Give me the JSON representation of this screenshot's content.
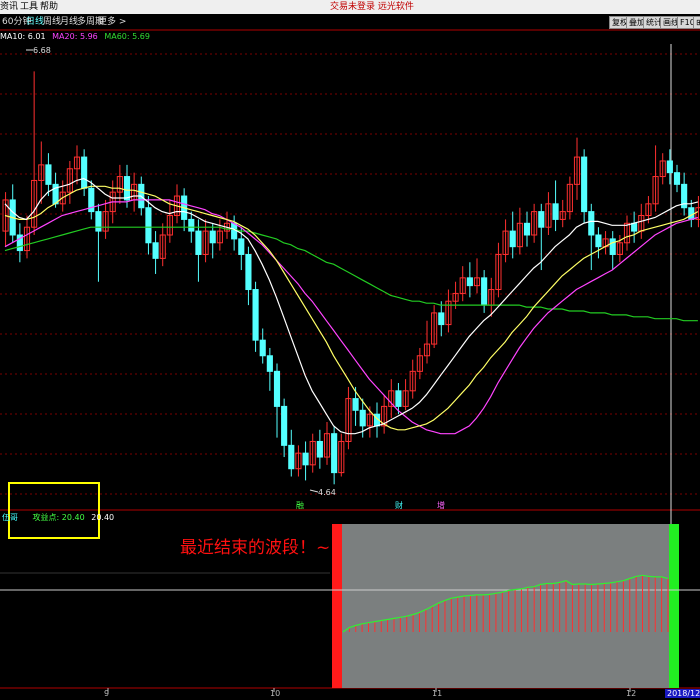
{
  "topbar": {
    "menu": [
      "资讯",
      "工具",
      "帮助"
    ],
    "title": "交易未登录 远光软件"
  },
  "tabbar": {
    "period": "60分钟",
    "tabs": [
      "日线",
      "周线",
      "月线",
      "多周期",
      "更多 >"
    ],
    "active_tab": "日线",
    "buttons": [
      "复权",
      "叠加",
      "统计",
      "画线",
      "F10"
    ],
    "extra_button": "⊞"
  },
  "ma_legend": {
    "ma10": "MA10: 6.01",
    "ma20": "MA20: 5.96",
    "ma60": "MA60: 5.69"
  },
  "price_labels": {
    "high": "6.68",
    "low": "4.64"
  },
  "event_marks": [
    "融",
    "财",
    "增"
  ],
  "indicator": {
    "name": "伍哥",
    "series_name": "攻益点: 20.40",
    "value": "20.40"
  },
  "annotation": "最近结束的波段！~",
  "x_ticks": [
    "9",
    "10",
    "11",
    "12",
    "2018/12/"
  ],
  "colors": {
    "up": "#ff3030",
    "down": "#54ffff",
    "ma10": "#ffffff",
    "ma20": "#ffff66",
    "ma30": "#ff44ff",
    "ma60": "#22cc22",
    "grid": "#7a0000",
    "band": "#7b7f7f",
    "band_start": "#ff1a1a",
    "band_end": "#22ee22"
  },
  "chart_data": [
    {
      "type": "candlestick",
      "title": "",
      "y_range": [
        4.5,
        6.8
      ],
      "candles": [
        [
          5.86,
          6.02,
          5.78,
          6.06
        ],
        [
          6.02,
          5.84,
          5.8,
          6.1
        ],
        [
          5.84,
          5.76,
          5.7,
          5.9
        ],
        [
          5.76,
          5.88,
          5.72,
          5.94
        ],
        [
          5.88,
          6.12,
          5.84,
          6.68
        ],
        [
          6.12,
          6.2,
          6.0,
          6.32
        ],
        [
          6.2,
          6.1,
          6.04,
          6.26
        ],
        [
          6.1,
          6.0,
          5.98,
          6.16
        ],
        [
          6.0,
          6.06,
          5.96,
          6.12
        ],
        [
          6.06,
          6.18,
          6.0,
          6.22
        ],
        [
          6.18,
          6.24,
          6.1,
          6.3
        ],
        [
          6.24,
          6.08,
          6.04,
          6.28
        ],
        [
          6.08,
          5.96,
          5.92,
          6.12
        ],
        [
          5.96,
          5.86,
          5.6,
          6.0
        ],
        [
          5.86,
          5.96,
          5.82,
          6.02
        ],
        [
          5.96,
          6.06,
          5.9,
          6.12
        ],
        [
          6.06,
          6.14,
          6.0,
          6.2
        ],
        [
          6.14,
          6.02,
          5.98,
          6.2
        ],
        [
          6.02,
          6.1,
          5.96,
          6.16
        ],
        [
          6.1,
          5.98,
          5.94,
          6.14
        ],
        [
          5.98,
          5.8,
          5.74,
          6.04
        ],
        [
          5.8,
          5.72,
          5.64,
          5.86
        ],
        [
          5.72,
          5.84,
          5.68,
          5.9
        ],
        [
          5.84,
          5.94,
          5.8,
          6.02
        ],
        [
          5.94,
          6.04,
          5.9,
          6.1
        ],
        [
          6.04,
          5.92,
          5.86,
          6.08
        ],
        [
          5.92,
          5.86,
          5.8,
          5.96
        ],
        [
          5.86,
          5.74,
          5.6,
          5.92
        ],
        [
          5.74,
          5.86,
          5.7,
          5.92
        ],
        [
          5.86,
          5.8,
          5.72,
          5.9
        ],
        [
          5.8,
          5.86,
          5.76,
          5.92
        ],
        [
          5.86,
          5.9,
          5.82,
          5.96
        ],
        [
          5.9,
          5.82,
          5.76,
          5.94
        ],
        [
          5.82,
          5.74,
          5.66,
          5.88
        ],
        [
          5.74,
          5.56,
          5.48,
          5.78
        ],
        [
          5.56,
          5.3,
          5.24,
          5.6
        ],
        [
          5.3,
          5.22,
          5.18,
          5.36
        ],
        [
          5.22,
          5.14,
          5.04,
          5.26
        ],
        [
          5.14,
          4.96,
          4.8,
          5.18
        ],
        [
          4.96,
          4.76,
          4.7,
          5.0
        ],
        [
          4.76,
          4.64,
          4.6,
          4.84
        ],
        [
          4.64,
          4.72,
          4.6,
          4.76
        ],
        [
          4.72,
          4.66,
          4.58,
          4.78
        ],
        [
          4.66,
          4.78,
          4.62,
          4.82
        ],
        [
          4.78,
          4.7,
          4.64,
          4.84
        ],
        [
          4.7,
          4.82,
          4.66,
          4.88
        ],
        [
          4.82,
          4.62,
          4.56,
          4.86
        ],
        [
          4.62,
          4.78,
          4.6,
          4.82
        ],
        [
          4.78,
          5.0,
          4.74,
          5.06
        ],
        [
          5.0,
          4.94,
          4.86,
          5.06
        ],
        [
          4.94,
          4.86,
          4.8,
          5.0
        ],
        [
          4.86,
          4.92,
          4.8,
          4.96
        ],
        [
          4.92,
          4.86,
          4.8,
          4.98
        ],
        [
          4.86,
          4.96,
          4.82,
          5.02
        ],
        [
          4.96,
          5.04,
          4.9,
          5.1
        ],
        [
          5.04,
          4.96,
          4.92,
          5.08
        ],
        [
          4.96,
          5.04,
          4.94,
          5.1
        ],
        [
          5.04,
          5.14,
          5.0,
          5.2
        ],
        [
          5.14,
          5.22,
          5.1,
          5.26
        ],
        [
          5.22,
          5.28,
          5.18,
          5.4
        ],
        [
          5.28,
          5.44,
          5.26,
          5.48
        ],
        [
          5.44,
          5.38,
          5.32,
          5.5
        ],
        [
          5.38,
          5.5,
          5.34,
          5.56
        ],
        [
          5.5,
          5.54,
          5.46,
          5.6
        ],
        [
          5.54,
          5.62,
          5.5,
          5.68
        ],
        [
          5.62,
          5.58,
          5.52,
          5.7
        ],
        [
          5.58,
          5.62,
          5.54,
          5.72
        ],
        [
          5.62,
          5.48,
          5.44,
          5.66
        ],
        [
          5.48,
          5.56,
          5.42,
          5.62
        ],
        [
          5.56,
          5.74,
          5.52,
          5.8
        ],
        [
          5.74,
          5.86,
          5.7,
          5.92
        ],
        [
          5.86,
          5.78,
          5.72,
          5.96
        ],
        [
          5.78,
          5.9,
          5.74,
          5.98
        ],
        [
          5.9,
          5.84,
          5.78,
          5.96
        ],
        [
          5.84,
          5.96,
          5.8,
          6.0
        ],
        [
          5.96,
          5.88,
          5.66,
          6.0
        ],
        [
          5.88,
          6.0,
          5.84,
          6.06
        ],
        [
          6.0,
          5.92,
          5.86,
          6.12
        ],
        [
          5.92,
          5.96,
          5.88,
          6.02
        ],
        [
          5.96,
          6.1,
          5.92,
          6.14
        ],
        [
          6.1,
          6.24,
          6.02,
          6.34
        ],
        [
          6.24,
          5.96,
          5.9,
          6.28
        ],
        [
          5.96,
          5.84,
          5.66,
          6.0
        ],
        [
          5.84,
          5.78,
          5.72,
          5.88
        ],
        [
          5.78,
          5.82,
          5.74,
          5.86
        ],
        [
          5.82,
          5.74,
          5.66,
          5.86
        ],
        [
          5.74,
          5.8,
          5.7,
          5.84
        ],
        [
          5.8,
          5.9,
          5.76,
          5.94
        ],
        [
          5.9,
          5.86,
          5.8,
          5.96
        ],
        [
          5.86,
          5.94,
          5.82,
          6.0
        ],
        [
          5.94,
          6.0,
          5.9,
          6.04
        ],
        [
          6.0,
          6.14,
          5.96,
          6.3
        ],
        [
          6.14,
          6.22,
          6.1,
          6.26
        ],
        [
          6.22,
          6.16,
          6.1,
          6.28
        ],
        [
          6.16,
          6.1,
          6.06,
          6.2
        ],
        [
          6.1,
          5.98,
          5.94,
          6.16
        ],
        [
          5.98,
          5.92,
          5.88,
          6.02
        ],
        [
          5.92,
          5.98,
          5.88,
          6.04
        ]
      ],
      "ma10": [
        6.0,
        5.96,
        5.93,
        5.92,
        5.96,
        6.02,
        6.06,
        6.08,
        6.09,
        6.1,
        6.12,
        6.13,
        6.11,
        6.08,
        6.05,
        6.03,
        6.03,
        6.03,
        6.04,
        6.04,
        6.01,
        5.98,
        5.96,
        5.95,
        5.96,
        5.96,
        5.95,
        5.93,
        5.91,
        5.9,
        5.89,
        5.88,
        5.87,
        5.85,
        5.82,
        5.76,
        5.69,
        5.61,
        5.52,
        5.42,
        5.32,
        5.22,
        5.12,
        5.04,
        4.98,
        4.92,
        4.86,
        4.83,
        4.82,
        4.82,
        4.83,
        4.85,
        4.86,
        4.87,
        4.89,
        4.91,
        4.93,
        4.95,
        4.98,
        5.02,
        5.07,
        5.12,
        5.17,
        5.22,
        5.27,
        5.32,
        5.36,
        5.4,
        5.43,
        5.47,
        5.51,
        5.55,
        5.59,
        5.63,
        5.67,
        5.7,
        5.74,
        5.78,
        5.81,
        5.84,
        5.88,
        5.9,
        5.91,
        5.91,
        5.9,
        5.89,
        5.89,
        5.89,
        5.9,
        5.91,
        5.92,
        5.93,
        5.95,
        5.97,
        5.99,
        6.0,
        6.0,
        6.01
      ],
      "ma20": [
        5.94,
        5.93,
        5.92,
        5.92,
        5.93,
        5.95,
        5.98,
        6.0,
        6.03,
        6.05,
        6.07,
        6.08,
        6.09,
        6.09,
        6.09,
        6.08,
        6.08,
        6.07,
        6.07,
        6.06,
        6.05,
        6.04,
        6.02,
        6.0,
        5.99,
        5.98,
        5.97,
        5.96,
        5.95,
        5.94,
        5.93,
        5.92,
        5.91,
        5.89,
        5.87,
        5.84,
        5.8,
        5.76,
        5.71,
        5.65,
        5.59,
        5.53,
        5.47,
        5.41,
        5.35,
        5.29,
        5.22,
        5.16,
        5.1,
        5.04,
        4.99,
        4.94,
        4.9,
        4.87,
        4.85,
        4.84,
        4.84,
        4.85,
        4.86,
        4.87,
        4.89,
        4.92,
        4.95,
        4.99,
        5.03,
        5.07,
        5.12,
        5.16,
        5.21,
        5.25,
        5.29,
        5.34,
        5.38,
        5.42,
        5.47,
        5.51,
        5.55,
        5.59,
        5.63,
        5.66,
        5.69,
        5.72,
        5.74,
        5.76,
        5.78,
        5.8,
        5.81,
        5.83,
        5.84,
        5.86,
        5.87,
        5.88,
        5.89,
        5.9,
        5.91,
        5.92,
        5.94,
        5.96
      ],
      "ma30": [
        5.78,
        5.8,
        5.82,
        5.84,
        5.86,
        5.88,
        5.9,
        5.92,
        5.94,
        5.95,
        5.96,
        5.97,
        5.98,
        5.99,
        6.0,
        6.01,
        6.01,
        6.01,
        6.02,
        6.02,
        6.02,
        6.02,
        6.02,
        6.02,
        6.01,
        6.0,
        5.99,
        5.98,
        5.97,
        5.95,
        5.94,
        5.92,
        5.9,
        5.88,
        5.85,
        5.82,
        5.79,
        5.75,
        5.71,
        5.67,
        5.63,
        5.59,
        5.54,
        5.5,
        5.45,
        5.4,
        5.35,
        5.3,
        5.25,
        5.2,
        5.15,
        5.1,
        5.06,
        5.02,
        4.98,
        4.94,
        4.91,
        4.88,
        4.86,
        4.84,
        4.83,
        4.82,
        4.82,
        4.82,
        4.84,
        4.86,
        4.9,
        4.95,
        5.01,
        5.08,
        5.14,
        5.2,
        5.26,
        5.31,
        5.36,
        5.4,
        5.44,
        5.47,
        5.5,
        5.53,
        5.56,
        5.58,
        5.6,
        5.62,
        5.64,
        5.66,
        5.69,
        5.72,
        5.75,
        5.78,
        5.81,
        5.84,
        5.86,
        5.88,
        5.9,
        5.91,
        5.92,
        5.93
      ],
      "ma60": [
        5.76,
        5.77,
        5.78,
        5.79,
        5.8,
        5.81,
        5.82,
        5.83,
        5.84,
        5.85,
        5.86,
        5.87,
        5.88,
        5.88,
        5.88,
        5.88,
        5.88,
        5.88,
        5.88,
        5.88,
        5.88,
        5.88,
        5.88,
        5.88,
        5.88,
        5.88,
        5.88,
        5.88,
        5.88,
        5.88,
        5.88,
        5.87,
        5.87,
        5.86,
        5.86,
        5.85,
        5.84,
        5.83,
        5.82,
        5.8,
        5.79,
        5.77,
        5.76,
        5.74,
        5.72,
        5.7,
        5.69,
        5.67,
        5.65,
        5.63,
        5.61,
        5.59,
        5.57,
        5.55,
        5.53,
        5.52,
        5.51,
        5.5,
        5.5,
        5.49,
        5.49,
        5.48,
        5.48,
        5.48,
        5.48,
        5.48,
        5.48,
        5.48,
        5.48,
        5.48,
        5.48,
        5.48,
        5.48,
        5.47,
        5.47,
        5.47,
        5.46,
        5.46,
        5.46,
        5.45,
        5.45,
        5.45,
        5.44,
        5.44,
        5.44,
        5.43,
        5.43,
        5.43,
        5.42,
        5.42,
        5.42,
        5.41,
        5.41,
        5.41,
        5.41,
        5.4,
        5.4,
        5.4
      ]
    },
    {
      "type": "line",
      "title": "",
      "series": [
        {
          "name": "攻益点",
          "values": [
            0.0,
            1.6,
            2.4,
            3.0,
            3.4,
            3.8,
            4.2,
            4.6,
            5.0,
            5.4,
            5.8,
            6.4,
            7.2,
            8.2,
            9.4,
            10.6,
            11.6,
            12.4,
            12.8,
            13.2,
            13.4,
            13.6,
            13.6,
            13.8,
            14.2,
            14.6,
            15.2,
            15.6,
            15.8,
            16.4,
            16.6,
            17.4,
            17.8,
            17.8,
            18.2,
            18.8,
            17.4,
            17.6,
            17.6,
            17.4,
            17.6,
            17.8,
            18.0,
            18.4,
            18.8,
            19.6,
            20.4,
            20.8,
            20.4,
            20.2,
            20.2,
            19.6
          ]
        }
      ],
      "band_start_index": 0,
      "band_end_index": 51
    }
  ]
}
